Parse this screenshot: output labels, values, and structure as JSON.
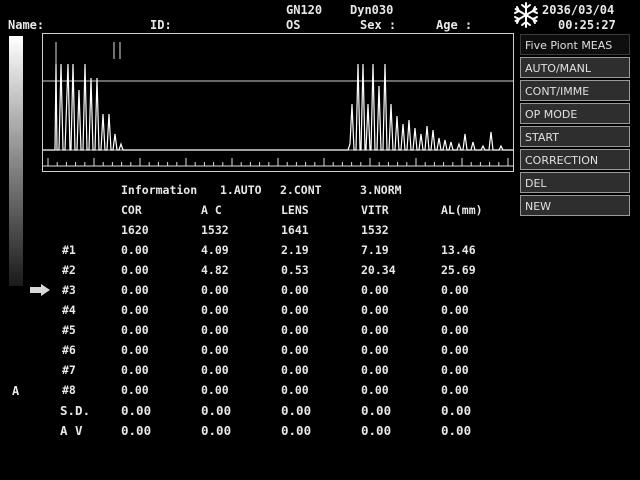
{
  "header": {
    "name_label": "Name:",
    "id_label": "ID:",
    "gain": "GN120",
    "dyn": "Dyn030",
    "eye": "OS",
    "sex_label": "Sex :",
    "age_label": "Age :",
    "date": "2036/03/04",
    "time": "00:25:27",
    "freeze_icon": "snowflake-icon"
  },
  "menu": {
    "title": "Five Piont MEAS",
    "items": [
      "AUTO/MANL",
      "CONT/IMME",
      "OP MODE",
      "START",
      "CORRECTION",
      "DEL",
      "NEW"
    ]
  },
  "info": {
    "label": "Information",
    "mode1": "1.AUTO",
    "mode2": "2.CONT",
    "mode3": "3.NORM"
  },
  "table": {
    "headers": [
      "COR",
      "A C",
      "LENS",
      "VITR",
      "AL(mm)"
    ],
    "velocities": [
      "1620",
      "1532",
      "1641",
      "1532"
    ],
    "rows": [
      {
        "label": "#1",
        "values": [
          "0.00",
          "4.09",
          "2.19",
          "7.19",
          "13.46"
        ]
      },
      {
        "label": "#2",
        "values": [
          "0.00",
          "4.82",
          "0.53",
          "20.34",
          "25.69"
        ]
      },
      {
        "label": "#3",
        "values": [
          "0.00",
          "0.00",
          "0.00",
          "0.00",
          "0.00"
        ]
      },
      {
        "label": "#4",
        "values": [
          "0.00",
          "0.00",
          "0.00",
          "0.00",
          "0.00"
        ]
      },
      {
        "label": "#5",
        "values": [
          "0.00",
          "0.00",
          "0.00",
          "0.00",
          "0.00"
        ]
      },
      {
        "label": "#6",
        "values": [
          "0.00",
          "0.00",
          "0.00",
          "0.00",
          "0.00"
        ]
      },
      {
        "label": "#7",
        "values": [
          "0.00",
          "0.00",
          "0.00",
          "0.00",
          "0.00"
        ]
      },
      {
        "label": "#8",
        "values": [
          "0.00",
          "0.00",
          "0.00",
          "0.00",
          "0.00"
        ]
      }
    ],
    "sd": {
      "label": "S.D.",
      "values": [
        "0.00",
        "0.00",
        "0.00",
        "0.00",
        "0.00"
      ]
    },
    "av": {
      "label": "A V",
      "values": [
        "0.00",
        "0.00",
        "0.00",
        "0.00",
        "0.00"
      ]
    },
    "current_row_indicator": "arrow-right-icon"
  },
  "side_marker": "A",
  "colors": {
    "background": "#000000",
    "text": "#e8e8e8",
    "menu_bg": "#2e2e2e"
  }
}
